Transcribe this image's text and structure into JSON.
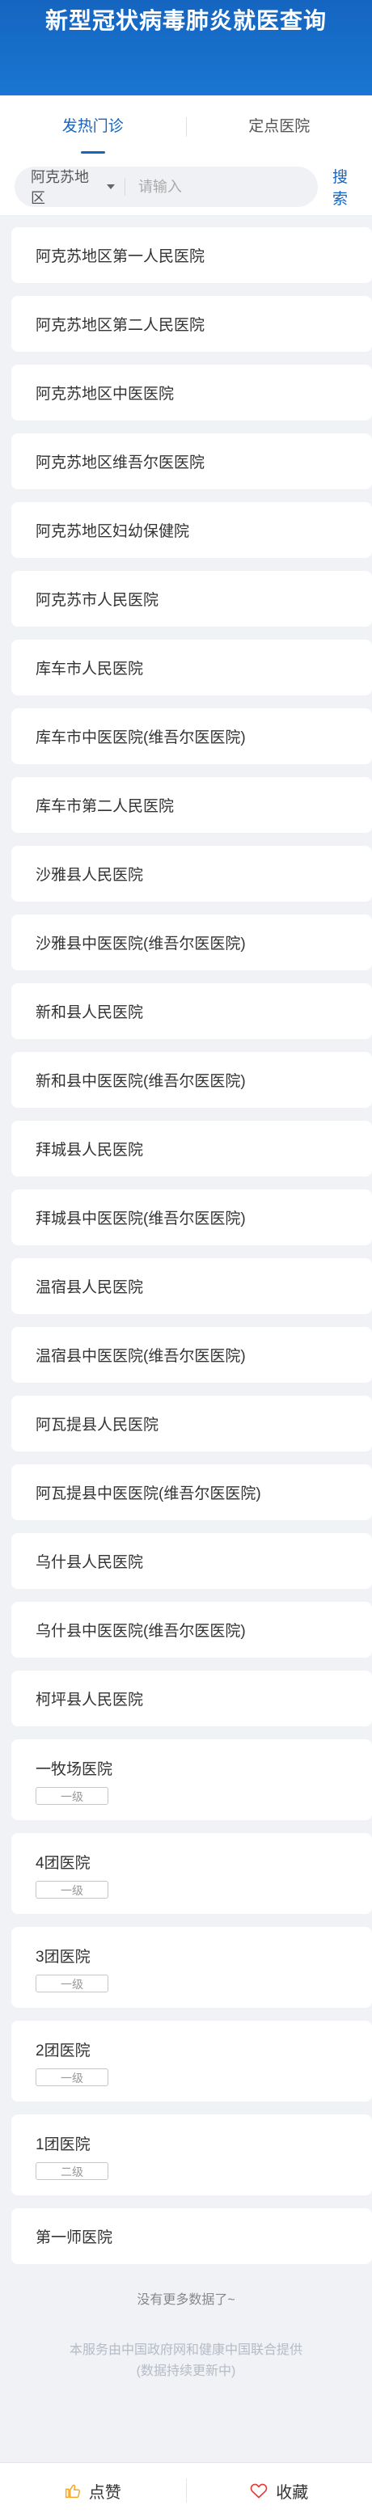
{
  "header": {
    "title": "新型冠状病毒肺炎就医查询"
  },
  "tabs": [
    {
      "label": "发热门诊",
      "active": true
    },
    {
      "label": "定点医院",
      "active": false
    }
  ],
  "search": {
    "region": "阿克苏地区",
    "placeholder": "请输入",
    "value": "",
    "button": "搜索"
  },
  "hospitals": [
    {
      "name": "阿克苏地区第一人民医院",
      "level": ""
    },
    {
      "name": "阿克苏地区第二人民医院",
      "level": ""
    },
    {
      "name": "阿克苏地区中医医院",
      "level": ""
    },
    {
      "name": "阿克苏地区维吾尔医医院",
      "level": ""
    },
    {
      "name": "阿克苏地区妇幼保健院",
      "level": ""
    },
    {
      "name": "阿克苏市人民医院",
      "level": ""
    },
    {
      "name": "库车市人民医院",
      "level": ""
    },
    {
      "name": "库车市中医医院(维吾尔医医院)",
      "level": ""
    },
    {
      "name": "库车市第二人民医院",
      "level": ""
    },
    {
      "name": "沙雅县人民医院",
      "level": ""
    },
    {
      "name": "沙雅县中医医院(维吾尔医医院)",
      "level": ""
    },
    {
      "name": "新和县人民医院",
      "level": ""
    },
    {
      "name": "新和县中医医院(维吾尔医医院)",
      "level": ""
    },
    {
      "name": "拜城县人民医院",
      "level": ""
    },
    {
      "name": "拜城县中医医院(维吾尔医医院)",
      "level": ""
    },
    {
      "name": "温宿县人民医院",
      "level": ""
    },
    {
      "name": "温宿县中医医院(维吾尔医医院)",
      "level": ""
    },
    {
      "name": "阿瓦提县人民医院",
      "level": ""
    },
    {
      "name": "阿瓦提县中医医院(维吾尔医医院)",
      "level": ""
    },
    {
      "name": "乌什县人民医院",
      "level": ""
    },
    {
      "name": "乌什县中医医院(维吾尔医医院)",
      "level": ""
    },
    {
      "name": "柯坪县人民医院",
      "level": ""
    },
    {
      "name": "一牧场医院",
      "level": "一级"
    },
    {
      "name": "4团医院",
      "level": "一级"
    },
    {
      "name": "3团医院",
      "level": "一级"
    },
    {
      "name": "2团医院",
      "level": "一级"
    },
    {
      "name": "1团医院",
      "level": "二级"
    },
    {
      "name": "第一师医院",
      "level": ""
    }
  ],
  "list_end": "没有更多数据了~",
  "footer_note": {
    "line1": "本服务由中国政府网和健康中国联合提供",
    "line2": "(数据持续更新中)"
  },
  "bottom_bar": {
    "like": {
      "label": "点赞",
      "icon": "thumbs-up-icon"
    },
    "favorite": {
      "label": "收藏",
      "icon": "heart-icon"
    }
  },
  "colors": {
    "brand": "#1565c0",
    "background": "#f0f2f5",
    "like_icon": "#f5a623",
    "heart_icon": "#e53935"
  }
}
